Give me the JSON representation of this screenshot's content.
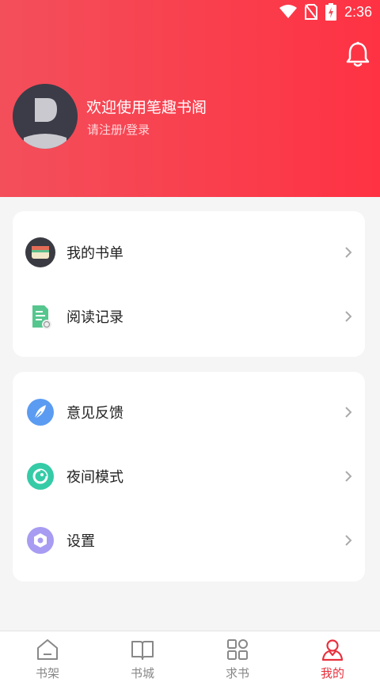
{
  "status_bar": {
    "time": "2:36"
  },
  "profile": {
    "welcome": "欢迎使用笔趣书阁",
    "login_prompt": "请注册/登录"
  },
  "menu_group_1": [
    {
      "label": "我的书单",
      "icon": "booklist-icon"
    },
    {
      "label": "阅读记录",
      "icon": "reading-history-icon"
    }
  ],
  "menu_group_2": [
    {
      "label": "意见反馈",
      "icon": "feedback-icon"
    },
    {
      "label": "夜间模式",
      "icon": "night-mode-icon"
    },
    {
      "label": "设置",
      "icon": "settings-icon"
    }
  ],
  "tabs": [
    {
      "label": "书架",
      "icon": "bookshelf-icon",
      "active": false
    },
    {
      "label": "书城",
      "icon": "bookstore-icon",
      "active": false
    },
    {
      "label": "求书",
      "icon": "request-icon",
      "active": false
    },
    {
      "label": "我的",
      "icon": "profile-icon",
      "active": true
    }
  ],
  "colors": {
    "header_start": "#f34f5b",
    "header_end": "#fe3243",
    "accent": "#e8303c",
    "background": "#f5f5f5"
  }
}
